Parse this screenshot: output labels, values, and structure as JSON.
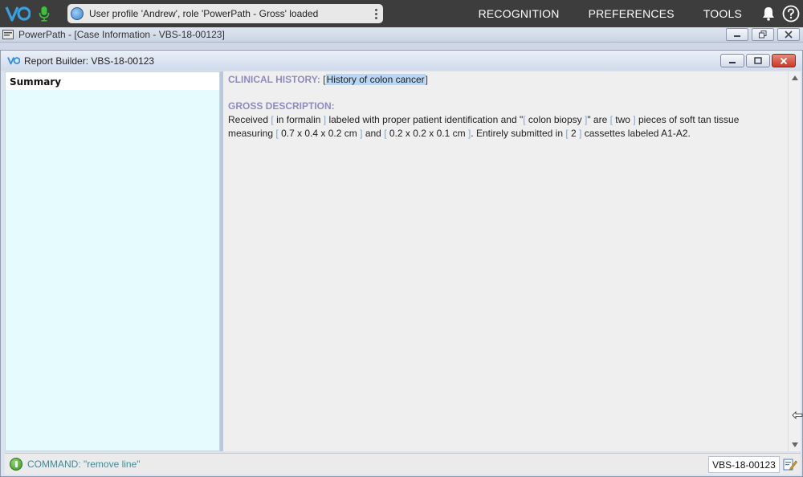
{
  "topbar": {
    "status_message": "User profile 'Andrew', role 'PowerPath - Gross' loaded",
    "menu": [
      "RECOGNITION",
      "PREFERENCES",
      "TOOLS"
    ]
  },
  "outer_window": {
    "title": "PowerPath - [Case Information - VBS-18-00123]"
  },
  "report_builder": {
    "title": "Report Builder: VBS-18-00123",
    "sidebar": {
      "items": [
        {
          "label": "Summary"
        }
      ]
    },
    "document": {
      "clinical_history": {
        "heading": "CLINICAL HISTORY:",
        "value": "History of colon cancer"
      },
      "gross_description": {
        "heading": "GROSS DESCRIPTION:",
        "t1": "Received",
        "f1": "in formalin",
        "t2": "labeled with proper patient identification and \"",
        "f2": "colon biopsy",
        "t3": "\" are",
        "f3": "two",
        "t4": "pieces of soft tan tissue measuring",
        "f4": "0.7 x 0.4 x 0.2 cm",
        "t5": "and",
        "f5": "0.2 x 0.2 x 0.1 cm",
        "t6": ". Entirely submitted in",
        "f6": "2",
        "t7": "cassettes labeled A1-A2."
      }
    },
    "statusbar": {
      "command": "COMMAND: \"remove line\"",
      "case_id": "VBS-18-00123"
    }
  },
  "colors": {
    "heading": "#8e8cbf",
    "bracket": "#7fa7d8",
    "highlight": "#b9d7f3",
    "topbar": "#3d3d3d",
    "vo_logo": "#3aa0e0",
    "mic": "#3cc13c"
  },
  "icons": [
    "vo-logo-icon",
    "mic-icon",
    "globe-icon",
    "kebab-menu-icon",
    "bell-icon",
    "help-icon",
    "app-icon",
    "minimize-icon",
    "restore-icon",
    "close-icon",
    "status-ok-icon",
    "edit-report-icon"
  ]
}
